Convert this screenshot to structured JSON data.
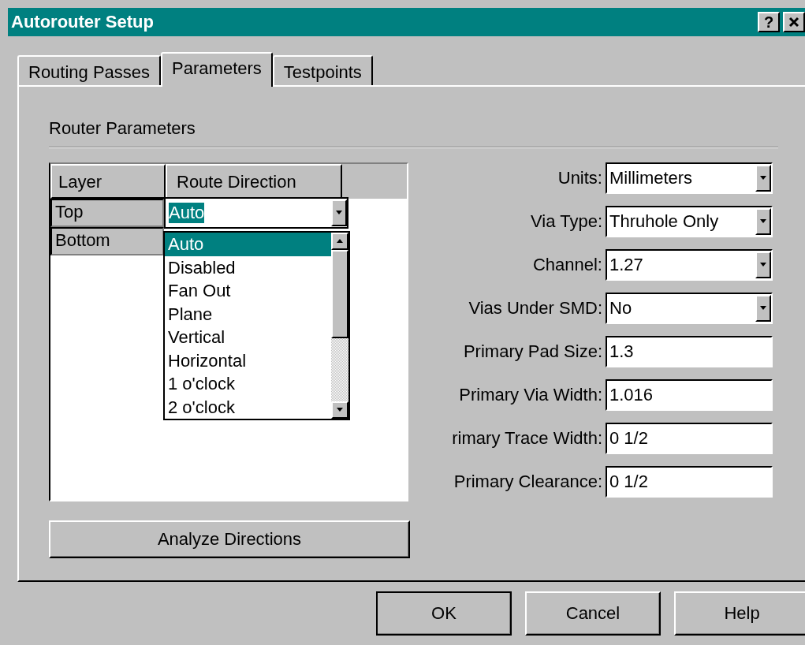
{
  "window": {
    "title": "Autorouter Setup",
    "help_button": "?"
  },
  "tabs": [
    {
      "label": "Routing Passes",
      "selected": false
    },
    {
      "label": "Parameters",
      "selected": true
    },
    {
      "label": "Testpoints",
      "selected": false
    }
  ],
  "group_title": "Router Parameters",
  "layer_table": {
    "columns": [
      "Layer",
      "Route Direction"
    ],
    "rows": [
      {
        "layer": "Top",
        "direction": "Auto"
      },
      {
        "layer": "Bottom"
      }
    ]
  },
  "direction_list": [
    {
      "label": "Auto",
      "selected": true
    },
    {
      "label": "Disabled",
      "selected": false
    },
    {
      "label": "Fan Out",
      "selected": false
    },
    {
      "label": "Plane",
      "selected": false
    },
    {
      "label": "Vertical",
      "selected": false
    },
    {
      "label": "Horizontal",
      "selected": false
    },
    {
      "label": "1 o'clock",
      "selected": false
    },
    {
      "label": "2 o'clock",
      "selected": false
    }
  ],
  "fields": [
    {
      "label": "Units:",
      "value": "Millimeters",
      "kind": "dropdown"
    },
    {
      "label": "Via Type:",
      "value": "Thruhole Only",
      "kind": "dropdown"
    },
    {
      "label": "Channel:",
      "value": "1.27",
      "kind": "dropdown"
    },
    {
      "label": "Vias Under SMD:",
      "value": "No",
      "kind": "dropdown"
    },
    {
      "label": "Primary Pad Size:",
      "value": "1.3",
      "kind": "text"
    },
    {
      "label": "Primary Via Width:",
      "value": "1.016",
      "kind": "text"
    },
    {
      "label": "rimary Trace Width:",
      "value": "0 1/2",
      "kind": "text"
    },
    {
      "label": "Primary Clearance:",
      "value": "0 1/2",
      "kind": "text"
    }
  ],
  "analyze_button": "Analyze Directions",
  "buttons": [
    {
      "label": "OK",
      "default": true
    },
    {
      "label": "Cancel",
      "default": false
    },
    {
      "label": "Help",
      "default": false
    }
  ]
}
